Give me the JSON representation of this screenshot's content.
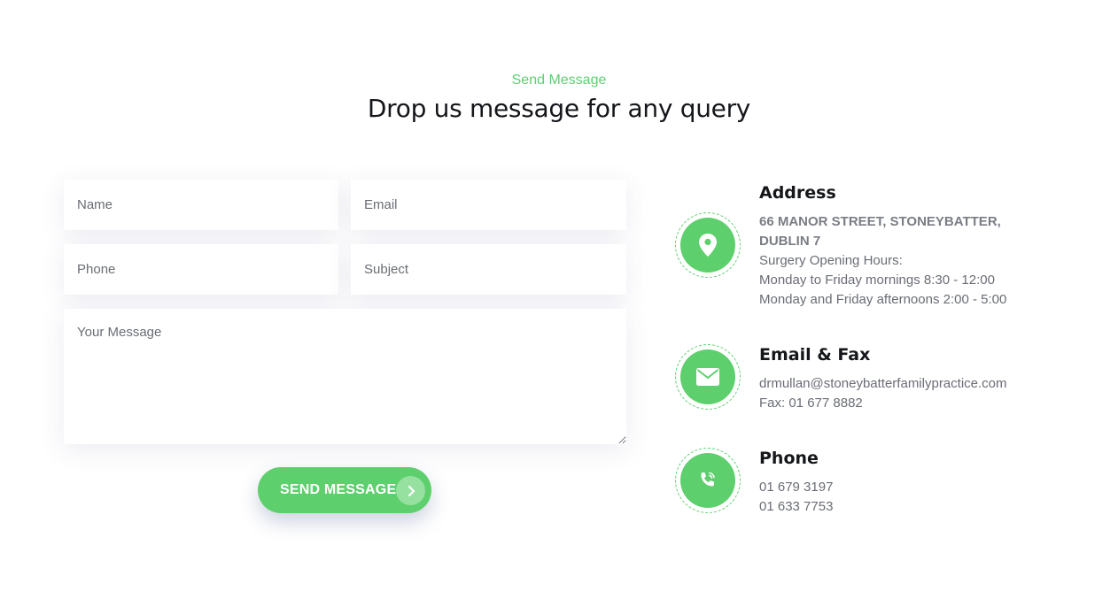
{
  "header": {
    "subtitle": "Send Message",
    "title": "Drop us message for any query"
  },
  "form": {
    "name_placeholder": "Name",
    "email_placeholder": "Email",
    "phone_placeholder": "Phone",
    "subject_placeholder": "Subject",
    "message_placeholder": "Your Message",
    "submit_label": "SEND MESSAGE",
    "submit_icon": "chevron-right-icon"
  },
  "contact": {
    "address": {
      "icon": "map-pin-icon",
      "title": "Address",
      "street_line1": "66 MANOR STREET, STONEYBATTER,",
      "street_line2": "DUBLIN 7",
      "hours_label": "Surgery Opening Hours:",
      "hours_line1": "Monday to Friday mornings 8:30 - 12:00",
      "hours_line2": "Monday and Friday afternoons 2:00 - 5:00"
    },
    "email": {
      "icon": "envelope-icon",
      "title": "Email & Fax",
      "email": "drmullan@stoneybatterfamilypractice.com",
      "fax": "Fax: 01 677 8882"
    },
    "phone": {
      "icon": "phone-ringing-icon",
      "title": "Phone",
      "number1": "01 679 3197",
      "number2": "01 633 7753"
    }
  },
  "colors": {
    "accent": "#5ecf6d",
    "heading": "#14161a",
    "body_text": "#6a6d75"
  }
}
